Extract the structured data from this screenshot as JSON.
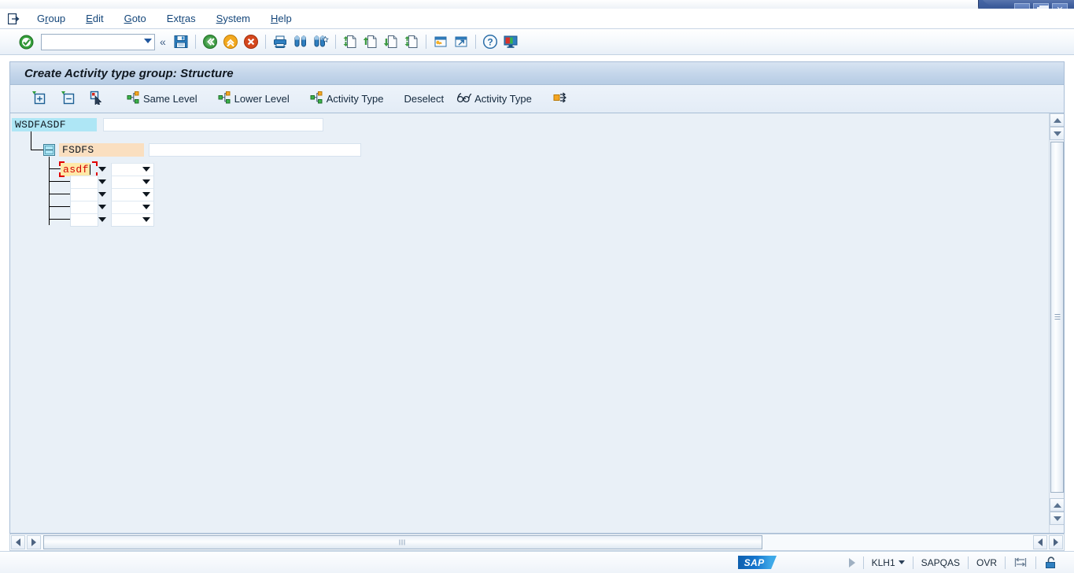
{
  "window": {
    "controls": [
      {
        "name": "minimize-button",
        "label": "_"
      },
      {
        "name": "restore-button",
        "label": "❐"
      },
      {
        "name": "close-button",
        "label": "✕"
      }
    ]
  },
  "menubar": {
    "system_icon": "system-menu-icon",
    "items": [
      {
        "label": "Group",
        "pre": "G",
        "key": "r",
        "post": "oup"
      },
      {
        "label": "Edit",
        "pre": "",
        "key": "E",
        "post": "dit"
      },
      {
        "label": "Goto",
        "pre": "",
        "key": "G",
        "post": "oto"
      },
      {
        "label": "Extras",
        "pre": "Ext",
        "key": "r",
        "post": "as"
      },
      {
        "label": "System",
        "pre": "",
        "key": "S",
        "post": "ystem"
      },
      {
        "label": "Help",
        "pre": "",
        "key": "H",
        "post": "elp"
      }
    ]
  },
  "systoolbar": {
    "enter_icon": "enter-check-icon",
    "command_field": {
      "value": "",
      "placeholder": ""
    },
    "collapse_icon": "double-chevron-left-icon",
    "icons": [
      "save-icon",
      "back-icon",
      "exit-icon",
      "cancel-icon",
      "print-icon",
      "find-icon",
      "find-next-icon",
      "first-page-icon",
      "previous-page-icon",
      "next-page-icon",
      "last-page-icon",
      "create-session-icon",
      "create-shortcut-icon",
      "help-icon",
      "customize-local-layout-icon"
    ]
  },
  "page": {
    "title": "Create Activity type group: Structure"
  },
  "apptoolbar": {
    "buttons": [
      {
        "name": "expand-all-button",
        "icon": "expand-node-icon",
        "label": ""
      },
      {
        "name": "collapse-all-button",
        "icon": "collapse-node-icon",
        "label": ""
      },
      {
        "name": "select-button",
        "icon": "select-pointer-icon",
        "label": ""
      },
      {
        "name": "same-level-button",
        "icon": "hierarchy-icon",
        "label": "Same Level"
      },
      {
        "name": "lower-level-button",
        "icon": "hierarchy-icon",
        "label": "Lower Level"
      },
      {
        "name": "activity-type-button",
        "icon": "hierarchy-icon",
        "label": "Activity Type"
      },
      {
        "name": "deselect-button",
        "icon": "",
        "label": "Deselect"
      },
      {
        "name": "display-activity-type-button",
        "icon": "glasses-icon",
        "label": "Activity Type"
      },
      {
        "name": "transfer-button",
        "icon": "transfer-arrows-icon",
        "label": ""
      }
    ]
  },
  "tree": {
    "root": {
      "name": "WSDFASDF",
      "description": "",
      "desc_placeholder": ""
    },
    "folder": {
      "name": "FSDFS",
      "description": "",
      "desc_placeholder": "",
      "expand_state": "expanded",
      "toggle_icon": "collapse-minus-icon"
    },
    "leaf_rows": [
      {
        "activity_type": "asdf",
        "second_value": "",
        "focused": true
      },
      {
        "activity_type": "",
        "second_value": "",
        "focused": false
      },
      {
        "activity_type": "",
        "second_value": "",
        "focused": false
      },
      {
        "activity_type": "",
        "second_value": "",
        "focused": false
      },
      {
        "activity_type": "",
        "second_value": "",
        "focused": false
      }
    ]
  },
  "statusbar": {
    "message": "",
    "logo": "SAP",
    "session_indicator": "session-play-icon",
    "system_client": "KLH1",
    "system_id": "SAPQAS",
    "insert_mode": "OVR",
    "data_transfer_icon": "data-transfer-icon",
    "secure_icon": "unlocked-icon"
  },
  "colors": {
    "title_bar": "#c3d5ea",
    "content_bg": "#e9f0f7",
    "root_highlight": "#aee6f5",
    "folder_highlight": "#fadfc0",
    "focus_field_bg": "#ffe9a8",
    "focus_text": "#d40000",
    "focus_border": "#e00000",
    "menu_text": "#14467a",
    "sap_blue": "#1577cf"
  }
}
